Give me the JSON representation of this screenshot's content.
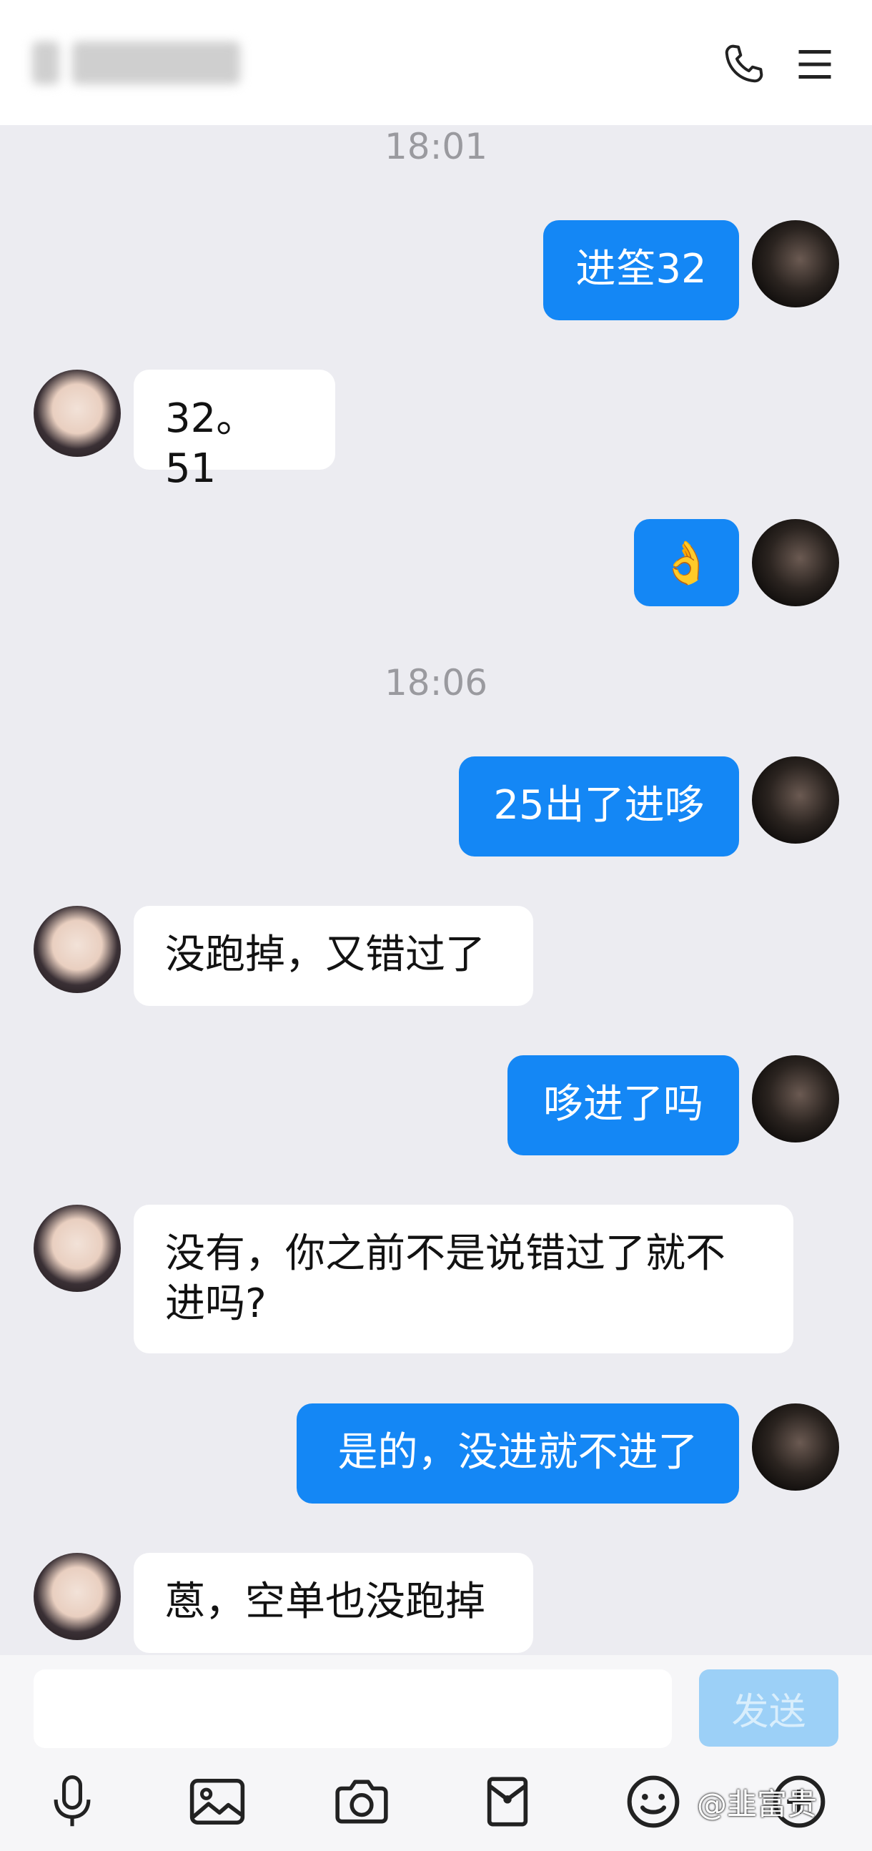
{
  "header": {
    "title_blurred": true
  },
  "timestamps": [
    "18:01",
    "18:06"
  ],
  "messages": [
    {
      "sender": "me",
      "text": "进筌32"
    },
    {
      "sender": "other",
      "text": "32。51"
    },
    {
      "sender": "me",
      "text": "👌",
      "emoji": "ok-hand"
    },
    {
      "sender": "me",
      "text": "25出了进哆"
    },
    {
      "sender": "other",
      "text": "没跑掉，又错过了"
    },
    {
      "sender": "me",
      "text": "哆进了吗"
    },
    {
      "sender": "other",
      "text": "没有，你之前不是说错过了就不\n进吗?"
    },
    {
      "sender": "me",
      "text": "是的，没进就不进了"
    },
    {
      "sender": "other",
      "text": "蒽，空单也没跑掉"
    }
  ],
  "input": {
    "value": "",
    "send_label": "发送"
  },
  "toolbar": [
    "mic-icon",
    "image-icon",
    "camera-icon",
    "red-packet-icon",
    "emoji-icon",
    "more-icon"
  ],
  "watermark": "@韭富贵",
  "colors": {
    "my_bubble": "#1487f5",
    "other_bubble": "#ffffff",
    "background": "#ececf1",
    "send_button": "#9cd0f7"
  }
}
